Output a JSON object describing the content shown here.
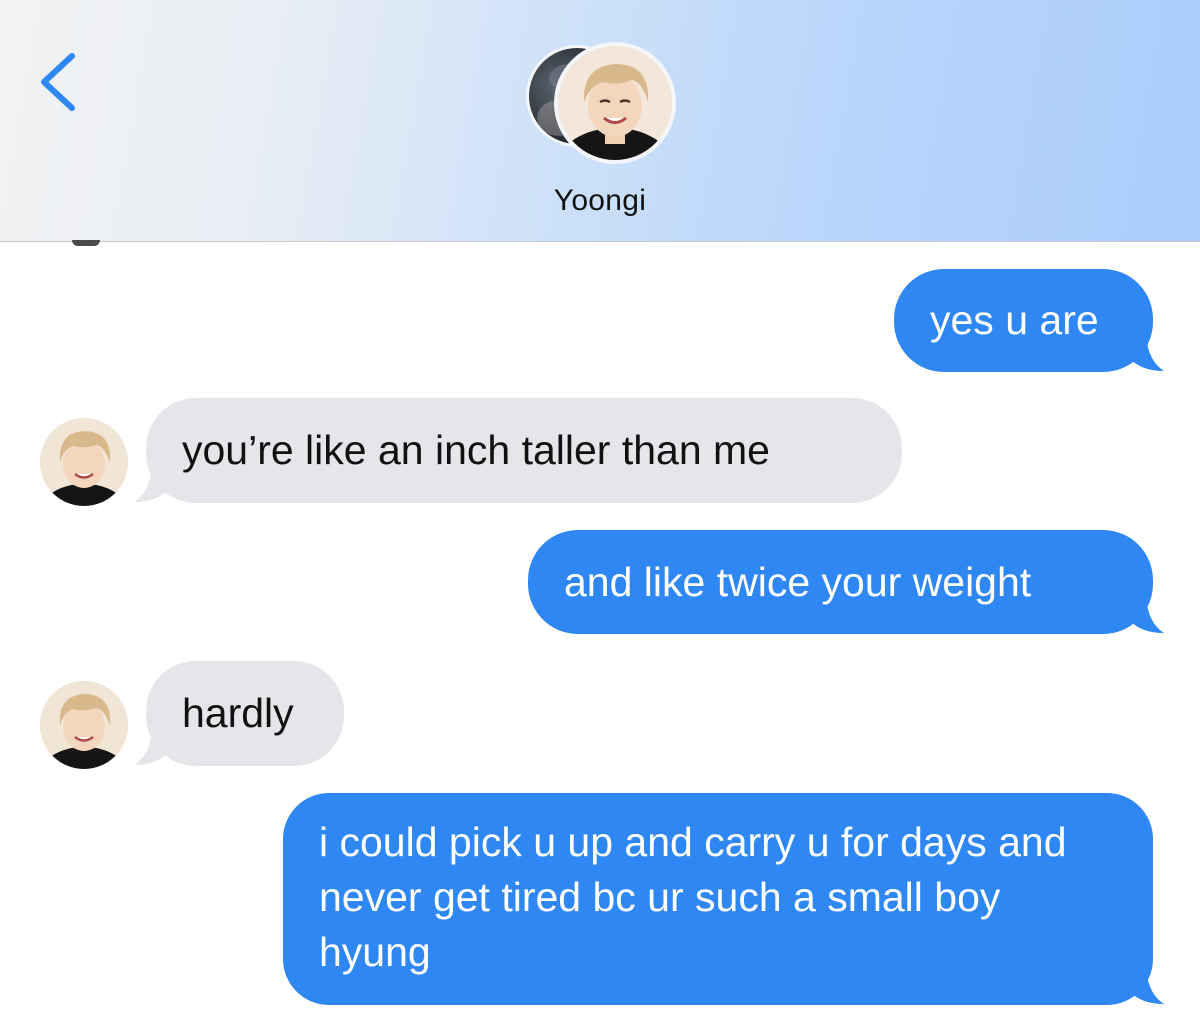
{
  "header": {
    "back_icon": "chevron-left-icon",
    "contact_name": "Yoongi"
  },
  "colors": {
    "sent_bubble": "#2f87f3",
    "received_bubble": "#e6e5ea",
    "accent": "#2f87f3"
  },
  "messages": [
    {
      "direction": "sent",
      "text": "yes u are"
    },
    {
      "direction": "received",
      "text": "you’re like an inch taller than me"
    },
    {
      "direction": "sent",
      "text": "and like twice your weight"
    },
    {
      "direction": "received",
      "text": "hardly"
    },
    {
      "direction": "sent",
      "text": "i could pick u up and carry u for days and never get tired bc ur such a small boy hyung"
    }
  ]
}
